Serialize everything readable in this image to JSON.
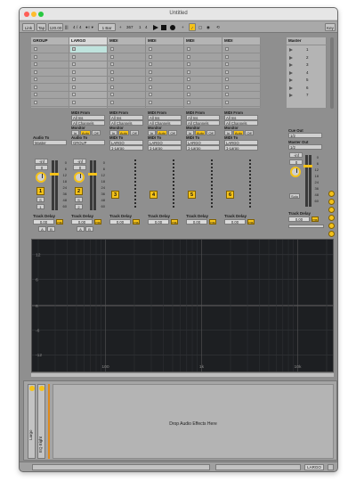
{
  "window": {
    "title": "Untitled"
  },
  "toolbar": {
    "link": "Link",
    "tap": "Tap",
    "tempo": "120.00",
    "meter_num": "4",
    "meter_den": "4",
    "quantize": "1 Bar",
    "position_bars": "367",
    "position_beats": "1",
    "position_sixteenths": "4",
    "key_label": "Key"
  },
  "tracks": [
    {
      "name": "GROUP",
      "selected": false
    },
    {
      "name": "LARGO",
      "selected": true
    },
    {
      "name": "MIDI",
      "selected": false
    },
    {
      "name": "MIDI",
      "selected": false
    },
    {
      "name": "MIDI",
      "selected": false
    },
    {
      "name": "MIDI",
      "selected": false
    }
  ],
  "master": {
    "name": "Master",
    "scenes": [
      "1",
      "2",
      "3",
      "4",
      "5",
      "6",
      "7"
    ]
  },
  "io": {
    "midi_from": "MIDI From",
    "all_ins": "All Ins",
    "all_channels": "All Channels",
    "monitor": "Monitor",
    "mon_in": "In",
    "mon_auto": "Auto",
    "mon_off": "Off",
    "midi_to": "MIDI To",
    "largo": "LARGO",
    "one_largo": "1-Largo",
    "audio_to": "Audio To",
    "master": "Master",
    "group": "GROUP",
    "cue_out": "Cue Out",
    "cue_value": "1/2",
    "master_out": "Master Out",
    "master_value": "1/2"
  },
  "mixer": {
    "neg_inf": "-inf",
    "zero": "0",
    "scale": [
      "0",
      "6",
      "12",
      "18",
      "24",
      "36",
      "48",
      "60"
    ],
    "track_numbers": [
      "1",
      "2",
      "3",
      "4",
      "5",
      "6"
    ],
    "s": "S",
    "solo": "Solo",
    "a": "A",
    "b": "B",
    "c_label": "C"
  },
  "delay": {
    "label": "Track Delay",
    "value": "0.00",
    "unit": "ms"
  },
  "plot": {
    "y_labels": [
      "12",
      "6",
      "0",
      "-6",
      "-12"
    ],
    "x_labels": [
      "100",
      "1k",
      "10k"
    ]
  },
  "device": {
    "drop_hint": "Drop Audio Effects Here",
    "chain_names": [
      "Largo",
      "EQ Eight"
    ]
  },
  "status": {
    "track_name": "LARGO"
  },
  "colors": {
    "accent": "#f4c21a",
    "panel": "#a2a2a2",
    "plot_bg": "#1d1f22"
  }
}
